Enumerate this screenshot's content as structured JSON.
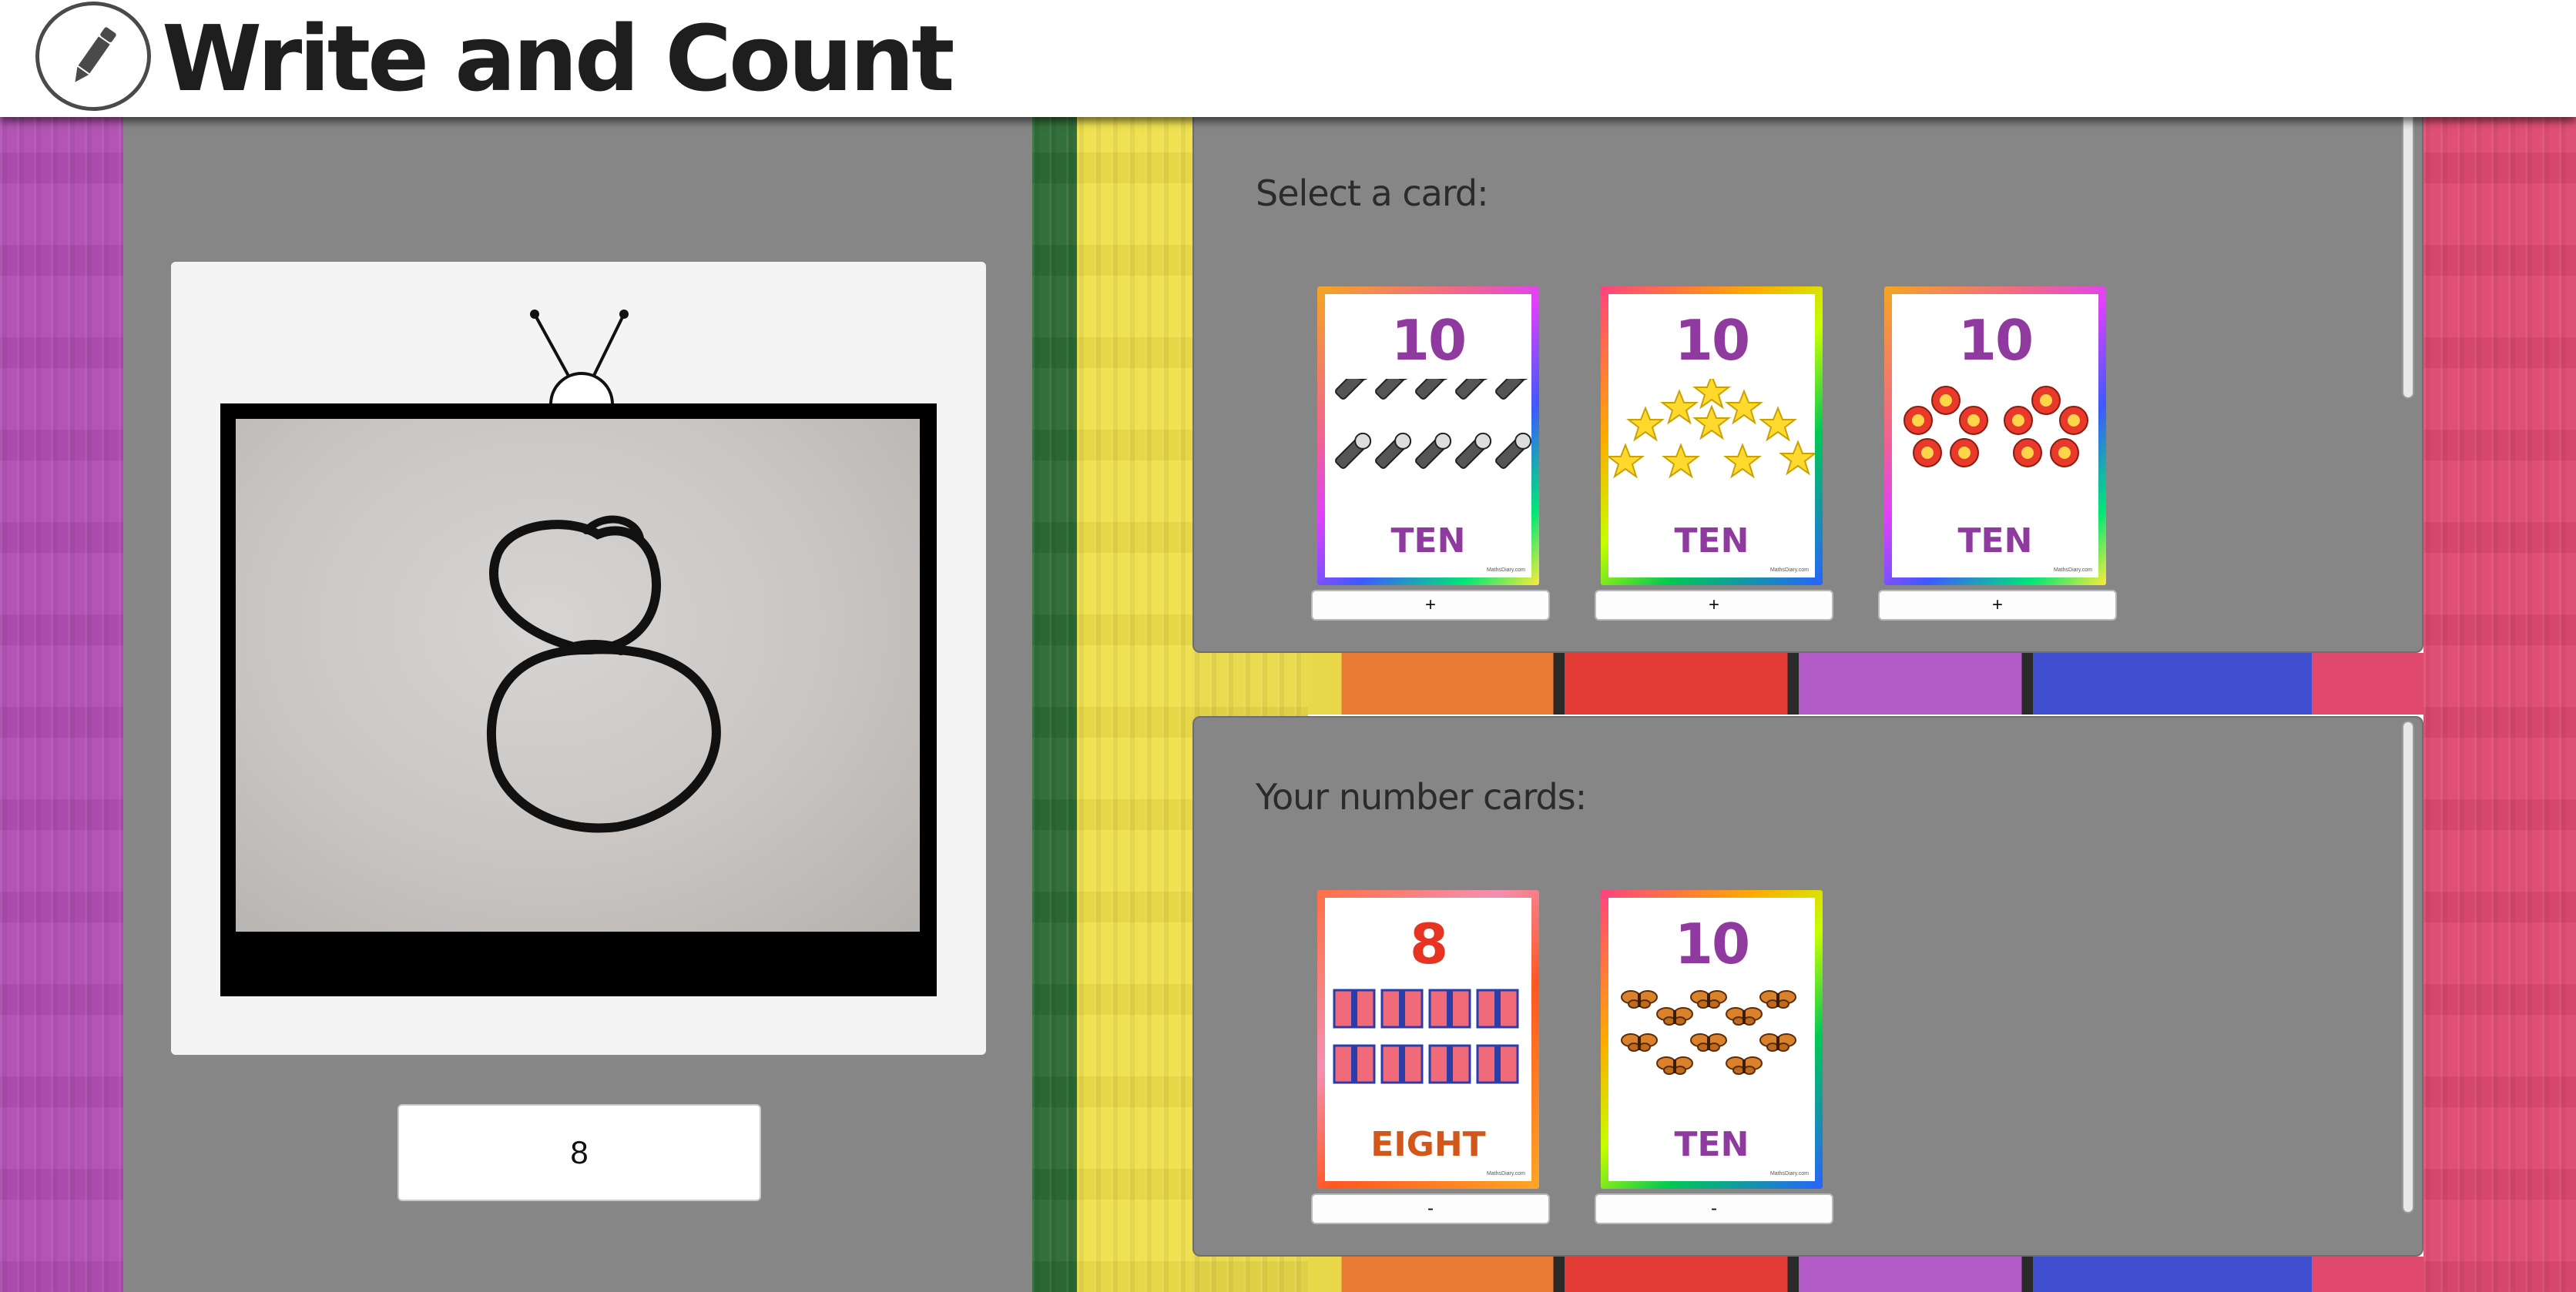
{
  "app": {
    "title": "Write and Count",
    "logo_icon": "pencil-icon"
  },
  "camera": {
    "detected_digit": "8",
    "input_value": "8"
  },
  "select_panel": {
    "heading": "Select a card:",
    "cards": [
      {
        "number": "10",
        "word": "TEN",
        "picture": "flashlights",
        "count": 10,
        "button_label": "+",
        "credit": "MathsDiary.com"
      },
      {
        "number": "10",
        "word": "TEN",
        "picture": "stars",
        "count": 10,
        "button_label": "+",
        "credit": "MathsDiary.com"
      },
      {
        "number": "10",
        "word": "TEN",
        "picture": "flowers",
        "count": 10,
        "button_label": "+",
        "credit": "MathsDiary.com"
      }
    ]
  },
  "your_panel": {
    "heading": "Your number cards:",
    "cards": [
      {
        "number": "8",
        "word": "EIGHT",
        "picture": "gift-boxes",
        "count": 8,
        "button_label": "-",
        "credit": "MathsDiary.com"
      },
      {
        "number": "10",
        "word": "TEN",
        "picture": "butterflies",
        "count": 10,
        "button_label": "-",
        "credit": "MathsDiary.com"
      }
    ]
  },
  "colors": {
    "panel_gray": "#878687",
    "ten_purple": "#8e3a9e",
    "eight_red": "#e63322",
    "plank_purple": "#b04fb0",
    "plank_yellow": "#f2e24a",
    "plank_pink": "#e0486e",
    "plank_green": "#2f6a34"
  }
}
